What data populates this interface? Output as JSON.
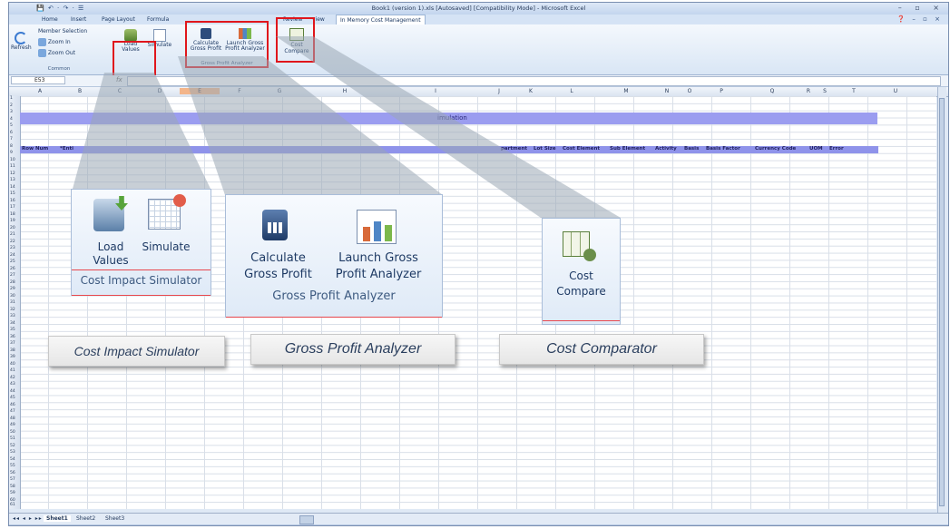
{
  "window": {
    "title": "Book1 (version 1).xls [Autosaved] [Compatibility Mode] - Microsoft Excel",
    "office_button": "Office",
    "quick_access": "💾 ↶ · ↷ · ☰",
    "controls": "– ▫ ×"
  },
  "tabs": [
    "Home",
    "Insert",
    "Page Layout",
    "Formula",
    "Review",
    "view",
    "In Memory Cost Management"
  ],
  "tabs_right": "❓ – ▫ ×",
  "ribbon": {
    "refresh": "Refresh",
    "member_selection": "Member Selection",
    "zoom_in": "Zoom In",
    "zoom_out": "Zoom Out",
    "common": "Common",
    "load_values": "Load Values",
    "simulate": "Simulate",
    "calculate_gross_profit": "Calculate Gross Profit",
    "launch_gross_profit_analyzer": "Launch Gross Profit Analyzer",
    "gross_profit_analyzer": "Gross Profit Analyzer",
    "cost_compare": "Cost Compare"
  },
  "formula_bar": {
    "name_box": "E53",
    "fx": "fx"
  },
  "columns": [
    "A",
    "B",
    "C",
    "D",
    "E",
    "F",
    "G",
    "H",
    "I",
    "J",
    "K",
    "L",
    "M",
    "N",
    "O",
    "P",
    "Q",
    "R",
    "S",
    "T",
    "U"
  ],
  "rows": [
    "1",
    "2",
    "3",
    "4",
    "5",
    "6",
    "7",
    "8",
    "9",
    "10",
    "11",
    "12",
    "13",
    "14",
    "15",
    "16",
    "17",
    "18",
    "19",
    "20",
    "21",
    "22",
    "23",
    "24",
    "25",
    "26",
    "27",
    "28",
    "29",
    "30",
    "31",
    "32",
    "33",
    "34",
    "35",
    "36",
    "37",
    "38",
    "39",
    "40",
    "41",
    "42",
    "43",
    "44",
    "45",
    "46",
    "47",
    "48",
    "49",
    "50",
    "51",
    "52",
    "53",
    "54",
    "55",
    "56",
    "57",
    "58",
    "59",
    "60",
    "61"
  ],
  "sheet": {
    "title_fragment": "imulation",
    "header_left": [
      "Row Num",
      "*Enti"
    ],
    "header_right": [
      "partment",
      "Lot Size",
      "Cost Element",
      "Sub Element",
      "Activity",
      "Basis",
      "Basis Factor",
      "Currency Code",
      "UOM",
      "Error"
    ]
  },
  "sheet_tabs": [
    "Sheet1",
    "Sheet2",
    "Sheet3"
  ],
  "zoom": {
    "cost_impact_simulator": {
      "load": "Load",
      "values": "Values",
      "simulate": "Simulate",
      "group": "Cost Impact Simulator"
    },
    "gross_profit_analyzer": {
      "calculate": "Calculate",
      "gross_profit": "Gross Profit",
      "launch_gross": "Launch Gross",
      "profit_analyzer": "Profit Analyzer",
      "group": "Gross Profit Analyzer"
    },
    "cost_compare": {
      "cost": "Cost",
      "compare": "Compare"
    }
  },
  "callouts": {
    "cost_impact_simulator": "Cost Impact Simulator",
    "gross_profit_analyzer": "Gross Profit Analyzer",
    "cost_comparator": "Cost Comparator"
  },
  "colors": {
    "highlight_red": "#e0161c",
    "title_band": "#9b9df0",
    "header_band": "#8f93ea",
    "ribbon_blue": "#dfe9f5"
  }
}
